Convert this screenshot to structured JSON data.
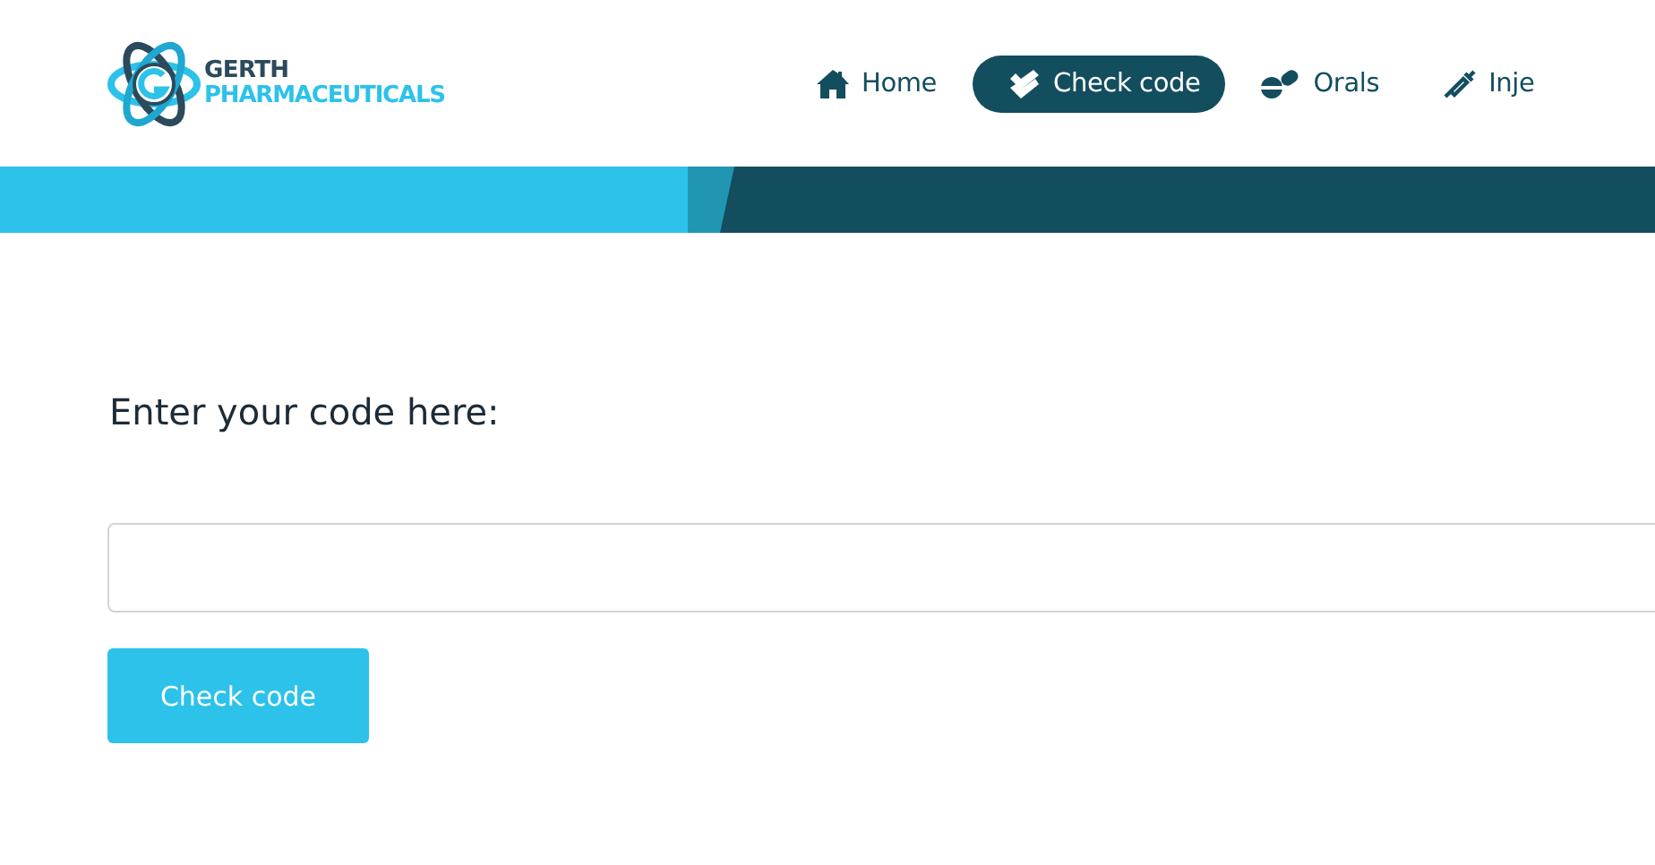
{
  "logo": {
    "line_1": "GERTH",
    "line_2": "PHARMACEUTICALS"
  },
  "nav": [
    {
      "label": "Home",
      "kind": "home",
      "selected": false
    },
    {
      "label": "Check code",
      "kind": "check",
      "selected": true
    },
    {
      "label": "Orals",
      "kind": "pills",
      "selected": false
    },
    {
      "label": "Inje",
      "kind": "syringe",
      "selected": false
    }
  ],
  "form": {
    "label": "Enter your code here:",
    "button": "Check code"
  }
}
